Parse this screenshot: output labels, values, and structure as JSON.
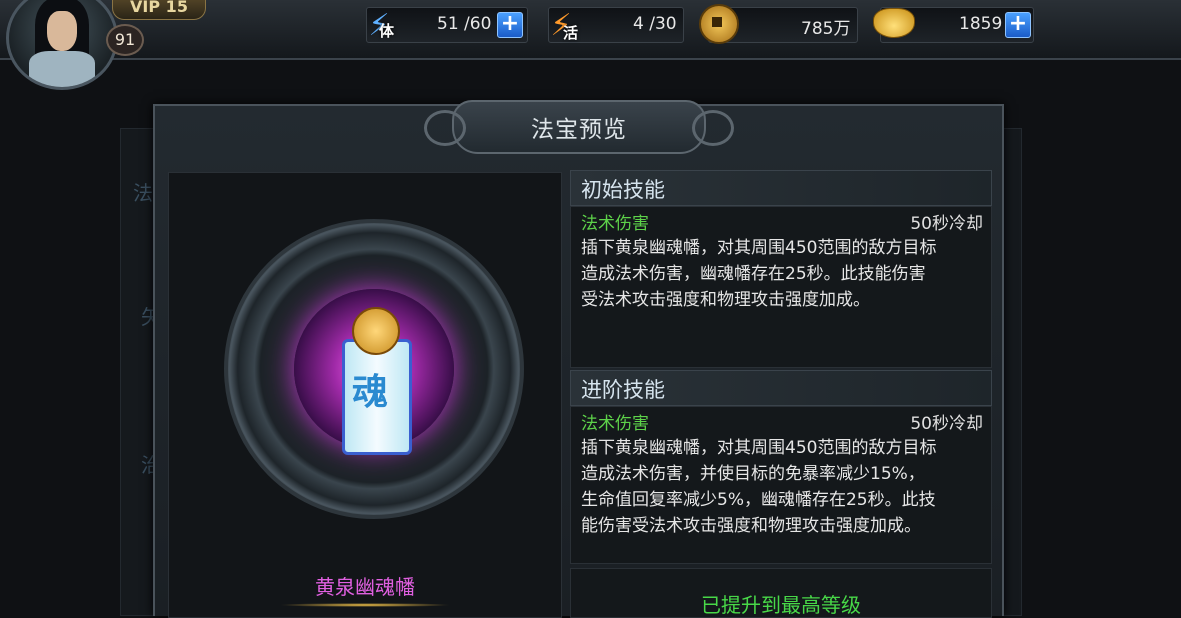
{
  "player": {
    "vip_label": "VIP 15",
    "level": "91"
  },
  "resources": {
    "stamina": {
      "icon_label": "体",
      "value": "51 /60",
      "icon": "lightning-icon"
    },
    "vitality": {
      "icon_label": "活",
      "value": "4 /30",
      "icon": "lightning-icon"
    },
    "copper": {
      "value": "785万",
      "icon": "coin-icon"
    },
    "gold": {
      "value": "1859",
      "icon": "gold-ingot-icon"
    },
    "plus": "+"
  },
  "dialog": {
    "title": "法宝预览",
    "item_name": "黄泉幽魂幡",
    "initial_skill": {
      "header": "初始技能",
      "name": "法术伤害",
      "cooldown": "50秒冷却",
      "description": "插下黄泉幽魂幡，对其周围450范围的敌方目标\n造成法术伤害，幽魂幡存在25秒。此技能伤害\n受法术攻击强度和物理攻击强度加成。"
    },
    "advanced_skill": {
      "header": "进阶技能",
      "name": "法术伤害",
      "cooldown": "50秒冷却",
      "description": "插下黄泉幽魂幡，对其周围450范围的敌方目标\n造成法术伤害，并使目标的免暴率减少15%，\n生命值回复率减少5%，幽魂幡存在25秒。此技\n能伤害受法术攻击强度和物理攻击强度加成。"
    },
    "max_level_text": "已提升到最高等级"
  },
  "background": {
    "chars": [
      "法",
      "矢",
      "治"
    ]
  },
  "colors": {
    "skill_name": "#5ed34a",
    "item_name": "#e060e0",
    "max_text": "#48d848"
  }
}
